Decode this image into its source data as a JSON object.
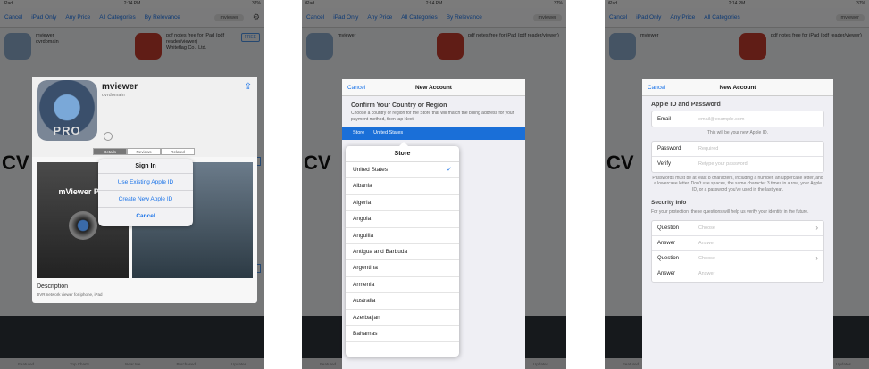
{
  "status": {
    "carrier": "iPad",
    "time": "2:14 PM",
    "battery": "37%"
  },
  "toolbar": {
    "cancel": "Cancel",
    "filters": [
      "iPad Only",
      "Any Price",
      "All Categories",
      "By Relevance"
    ],
    "search": "mviewer"
  },
  "bg": {
    "app1_name": "mviewer",
    "app1_dev": "dvrdomain",
    "app2_name": "pdf notes free for iPad (pdf reader/viewer)",
    "app2_dev": "Whiteflag Co., Ltd.",
    "free": "FREE",
    "cw_text": "CV",
    "side_free": "FREE",
    "side_price": "$4.99",
    "tabs": [
      "Featured",
      "Top Charts",
      "Near Me",
      "Purchased",
      "Updates"
    ]
  },
  "screen1": {
    "app_name": "mviewer",
    "developer": "dvrdomain",
    "badge": "PRO",
    "segments": [
      "Details",
      "Reviews",
      "Related"
    ],
    "shot_title": "mViewer Pro",
    "desc_title": "Description",
    "desc_text": "DVR network viewer for iphone, iPad",
    "alert": {
      "title": "Sign In",
      "existing": "Use Existing Apple ID",
      "create": "Create New Apple ID",
      "cancel": "Cancel"
    }
  },
  "screen2": {
    "nav": {
      "cancel": "Cancel",
      "title": "New Account"
    },
    "confirm_title": "Confirm Your Country or Region",
    "confirm_desc": "Choose a country or region for the Store that will match the billing address for your payment method, then tap Next.",
    "store_label": "Store",
    "store_value": "United States",
    "popover_title": "Store",
    "countries": [
      "United States",
      "Albania",
      "Algeria",
      "Angola",
      "Anguilla",
      "Antigua and Barbuda",
      "Argentina",
      "Armenia",
      "Australia",
      "Azerbaijan",
      "Bahamas"
    ],
    "selected_index": 0
  },
  "screen3": {
    "nav": {
      "cancel": "Cancel",
      "title": "New Account"
    },
    "section_title": "Apple ID and Password",
    "email_label": "Email",
    "email_placeholder": "email@example.com",
    "email_note": "This will be your new Apple ID.",
    "password_label": "Password",
    "password_placeholder": "Required",
    "verify_label": "Verify",
    "verify_placeholder": "Retype your password",
    "password_note": "Passwords must be at least 8 characters, including a number, an uppercase letter, and a lowercase letter. Don't use spaces, the same character 3 times in a row, your Apple ID, or a password you've used in the last year.",
    "security_title": "Security Info",
    "security_note": "For your protection, these questions will help us verify your identity in the future.",
    "question_label": "Question",
    "question_placeholder": "Choose",
    "answer_label": "Answer",
    "answer_placeholder": "Answer"
  },
  "colors": {
    "accent": "#1a73e8",
    "store_bar": "#1a6fd8"
  }
}
